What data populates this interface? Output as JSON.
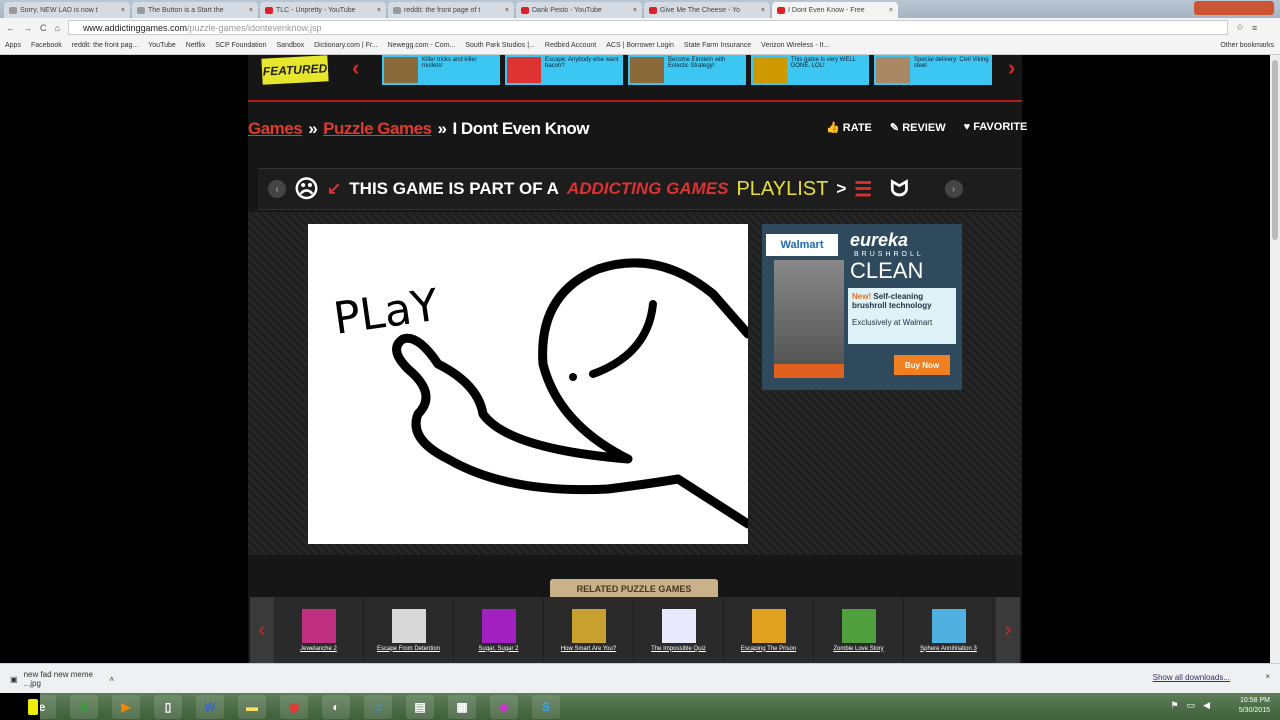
{
  "browser": {
    "tabs": [
      {
        "label": "Sorry, NEW LAD is now t",
        "icon": "generic",
        "active": false
      },
      {
        "label": "The Button is a Start the",
        "icon": "generic",
        "active": false
      },
      {
        "label": "TLC - Unpretty - YouTube",
        "icon": "youtube",
        "active": false
      },
      {
        "label": "reddit: the front page of t",
        "icon": "generic",
        "active": false
      },
      {
        "label": "Dank Pesto - YouTube",
        "icon": "youtube",
        "active": false
      },
      {
        "label": "Give Me The Cheese - Yo",
        "icon": "youtube",
        "active": false
      },
      {
        "label": "I Dont Even Know - Free",
        "icon": "addicting",
        "active": true
      }
    ],
    "url_host": "www.addictinggames.com",
    "url_path": "/puzzle-games/idontevenknow.jsp",
    "bookmarks": [
      "Apps",
      "Facebook",
      "reddit: the front pag...",
      "YouTube",
      "Netflix",
      "SCP Foundation",
      "Sandbox",
      "Dictionary.com | Fr...",
      "Newegg.com - Com...",
      "South Park Studios |...",
      "Redbird Account",
      "ACS | Borrower Login",
      "State Farm Insurance",
      "Verizon Wireless - It..."
    ],
    "other_bookmarks": "Other bookmarks"
  },
  "featured": {
    "label": "FEATURED",
    "items": [
      "Killer tricks and killer mullets!",
      "Escape: Anybody else want bacon?",
      "Become Einstein with Eclectic Strategy!",
      "This game is very WELL DONE. LOL!",
      "Special delivery: Civil Viking steel"
    ]
  },
  "breadcrumb": {
    "games": "Games",
    "sep": "»",
    "category": "Puzzle Games",
    "current": "I Dont Even Know"
  },
  "actions": {
    "rate": "RATE",
    "review": "REVIEW",
    "favorite": "FAVORITE"
  },
  "playlist_banner": {
    "part1": "THIS GAME IS PART OF A",
    "brand": "ADDICTING GAMES",
    "playlist": "PLAYLIST",
    "arrow": ">"
  },
  "game": {
    "play_text": "PLaY"
  },
  "ad": {
    "retailer": "Walmart",
    "brand": "eureka",
    "line1": "BRUSHROLL",
    "line2": "CLEAN",
    "new": "New!",
    "feature": "Self-cleaning brushroll technology",
    "exclusive": "Exclusively at Walmart",
    "cta": "Buy Now"
  },
  "related": {
    "label": "RELATED PUZZLE GAMES",
    "games": [
      {
        "title": "Jewelanche 2",
        "color": "#c03080"
      },
      {
        "title": "Escape From Detention",
        "color": "#d8d8d8"
      },
      {
        "title": "Sugar, Sugar 2",
        "color": "#a020c0"
      },
      {
        "title": "How Smart Are You?",
        "color": "#c8a030"
      },
      {
        "title": "The Impossible Quiz",
        "color": "#e8e8ff"
      },
      {
        "title": "Escaping The Prison",
        "color": "#e0a020"
      },
      {
        "title": "Zombie Love Story",
        "color": "#50a040"
      },
      {
        "title": "Sphere Annihilation 3",
        "color": "#50b0e0"
      }
    ]
  },
  "downloads": {
    "file": "new fad new meme ...jpg",
    "show_all": "Show all downloads..."
  },
  "taskbar": {
    "time": "10:58 PM",
    "date": "5/30/2015",
    "apps": [
      "ie",
      "excel",
      "media",
      "files",
      "word",
      "folder",
      "chrome",
      "steam",
      "itunes",
      "doc",
      "game",
      "app",
      "skype"
    ]
  }
}
